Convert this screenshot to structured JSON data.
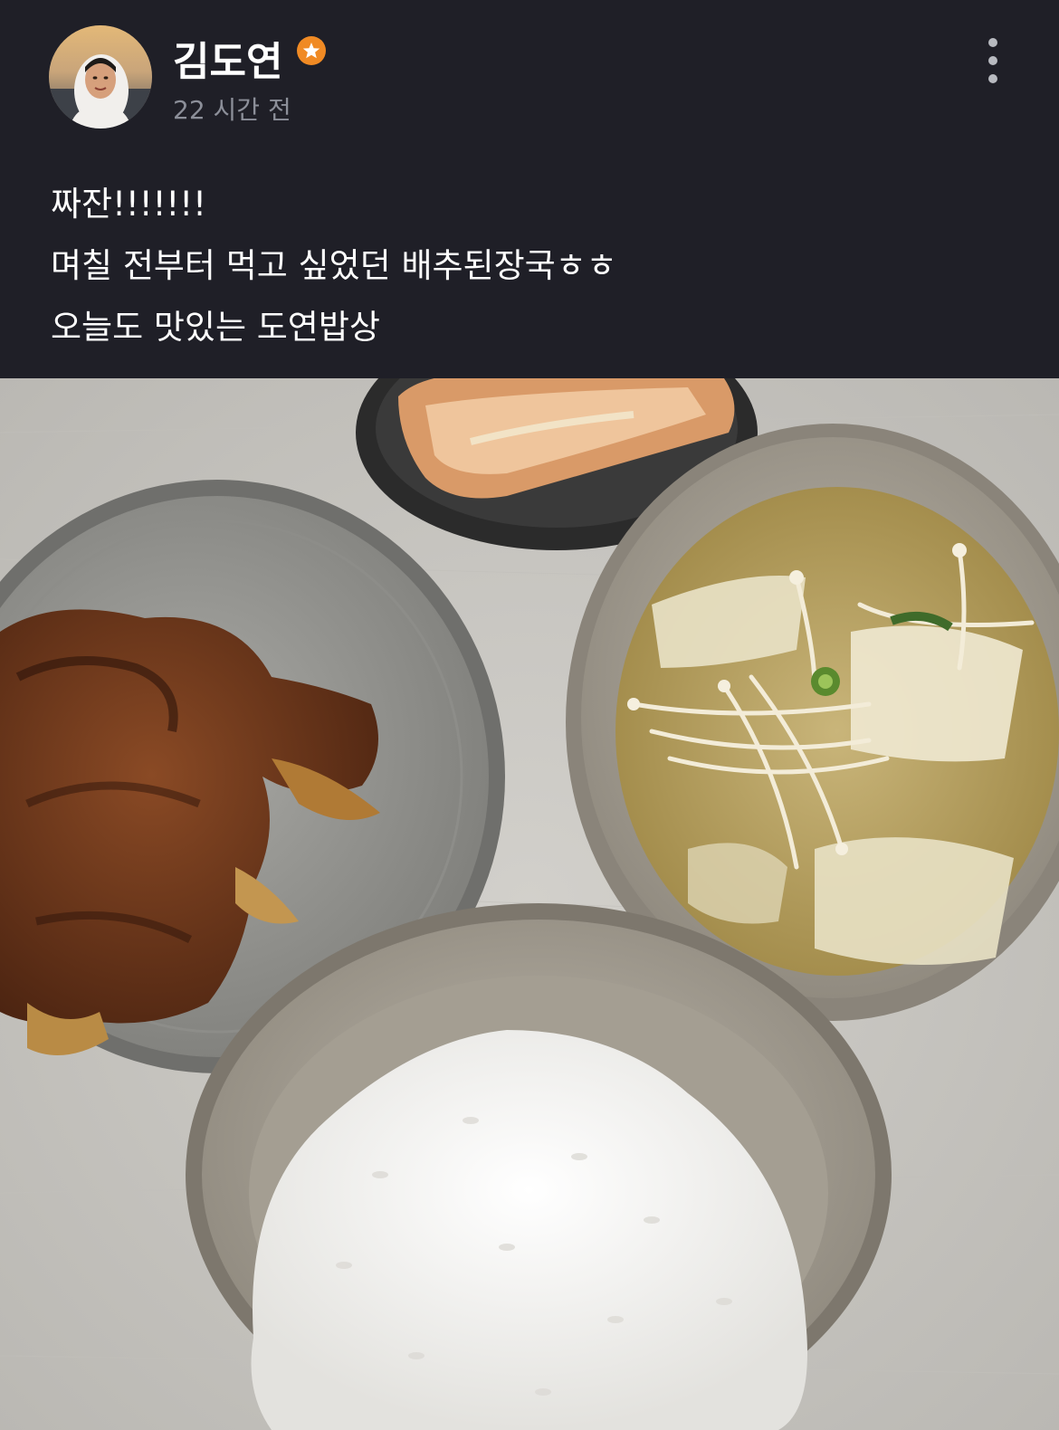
{
  "post": {
    "author": {
      "name": "김도연",
      "badge_icon": "star-badge-icon",
      "badge_color": "#f08a24"
    },
    "time": "22 시간 전",
    "more_icon": "more-vertical-icon",
    "caption": [
      "짜잔!!!!!!!",
      "며칠 전부터 먹고 싶었던 배추된장국ㅎㅎ",
      "오늘도 맛있는 도연밥상"
    ]
  },
  "colors": {
    "background": "#1f1f27",
    "text_primary": "#ffffff",
    "text_secondary": "#8c8f99"
  }
}
